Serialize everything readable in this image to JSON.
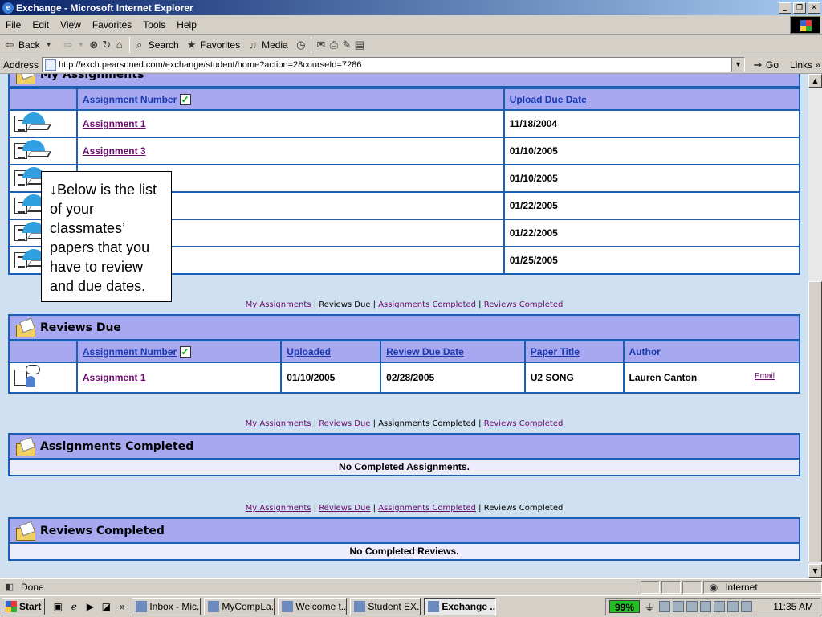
{
  "window": {
    "title": "Exchange - Microsoft Internet Explorer",
    "minimize": "_",
    "maximize": "❐",
    "close": "✕"
  },
  "menu": [
    "File",
    "Edit",
    "View",
    "Favorites",
    "Tools",
    "Help"
  ],
  "toolbar": {
    "back": "Back",
    "search": "Search",
    "favorites": "Favorites",
    "media": "Media"
  },
  "address": {
    "label": "Address",
    "url": "http://exch.pearsoned.com/exchange/student/home?action=28courseId=7286",
    "go": "Go",
    "links": "Links"
  },
  "my_assignments": {
    "title": "My Assignments",
    "columns": [
      "Assignment Number",
      "Upload Due Date"
    ],
    "rows": [
      {
        "name": "Assignment 1",
        "date": "11/18/2004"
      },
      {
        "name": "Assignment 3",
        "date": "01/10/2005"
      },
      {
        "name": "",
        "date": "01/10/2005"
      },
      {
        "name": "",
        "date": "01/22/2005"
      },
      {
        "name": "",
        "date": "01/22/2005"
      },
      {
        "name": "",
        "date": "01/25/2005"
      }
    ]
  },
  "callout": "↓Below is the list of your classmates’ papers that you have to review and due dates.",
  "nav": {
    "my_assignments": "My Assignments",
    "reviews_due": "Reviews Due",
    "assignments_completed": "Assignments Completed",
    "reviews_completed": "Reviews Completed",
    "sep": " | "
  },
  "reviews_due": {
    "title": "Reviews Due",
    "columns": [
      "Assignment Number",
      "Uploaded",
      "Review Due Date",
      "Paper Title",
      "Author"
    ],
    "rows": [
      {
        "assignment": "Assignment 1",
        "uploaded": "01/10/2005",
        "due": "02/28/2005",
        "paper": "U2 SONG",
        "author": "Lauren Canton",
        "email": "Email"
      }
    ]
  },
  "assignments_completed": {
    "title": "Assignments Completed",
    "empty": "No Completed Assignments."
  },
  "reviews_completed": {
    "title": "Reviews Completed",
    "empty": "No Completed Reviews."
  },
  "status": {
    "text": "Done",
    "zone": "Internet"
  },
  "taskbar": {
    "start": "Start",
    "tasks": [
      "Inbox - Mic...",
      "MyCompLa...",
      "Welcome t...",
      "Student EX...",
      "Exchange ..."
    ],
    "battery": "99%",
    "clock": "11:35 AM"
  }
}
